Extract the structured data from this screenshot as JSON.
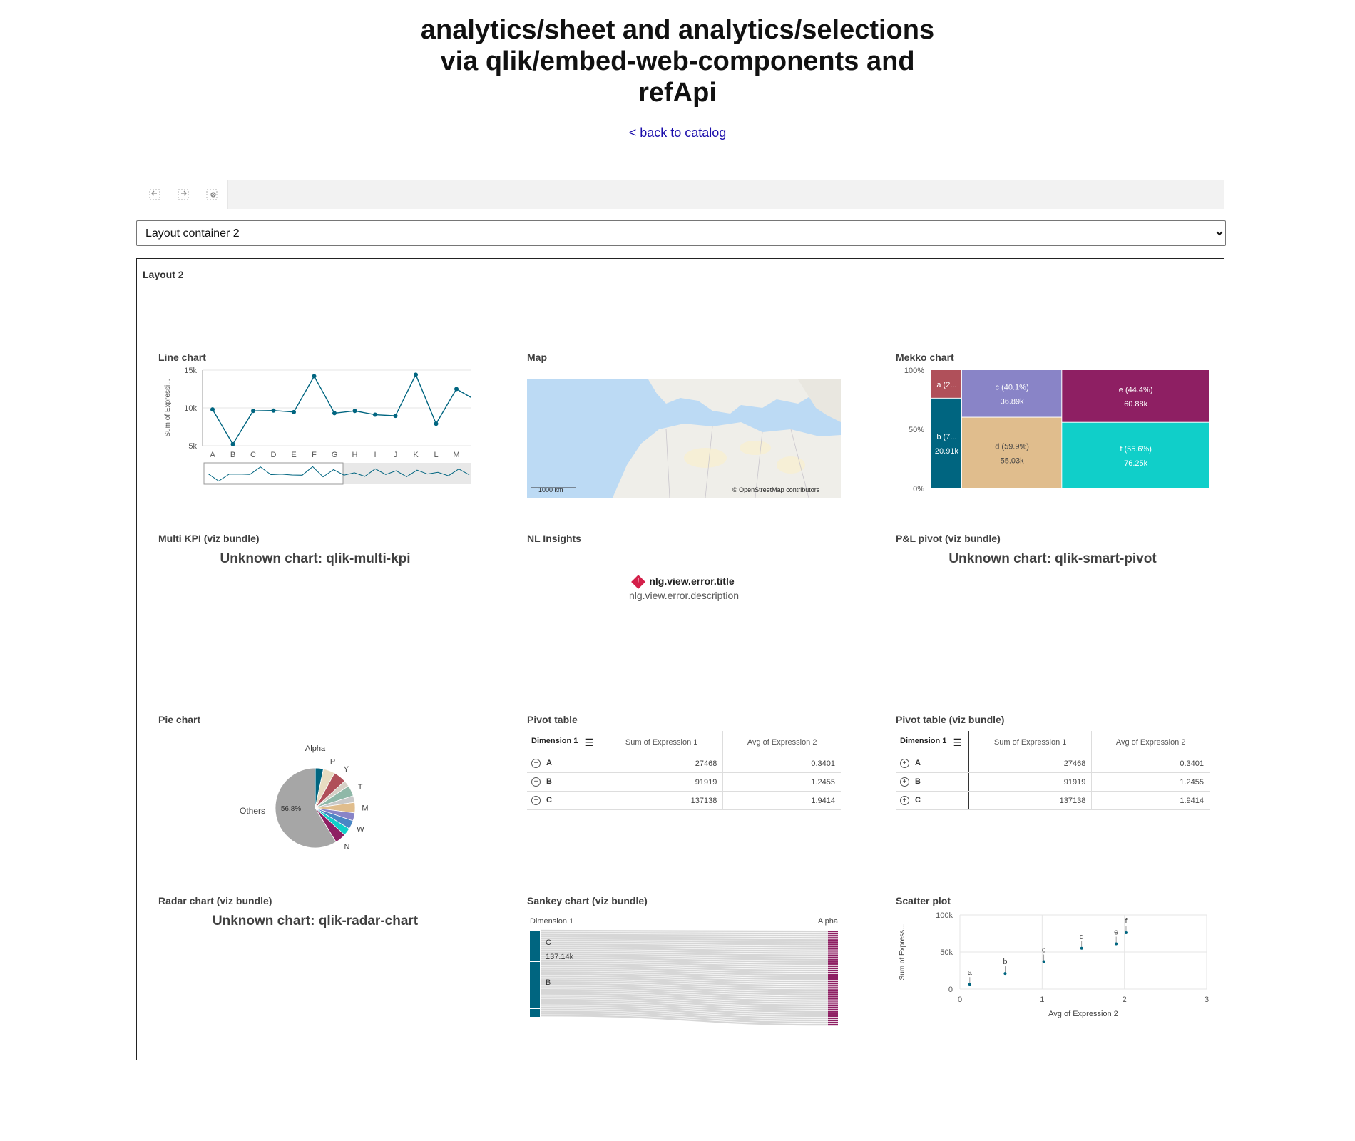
{
  "header": {
    "title_line1": "analytics/sheet and analytics/selections",
    "title_line2": "via qlik/embed-web-components and",
    "title_line3": "refApi",
    "back_link": "< back to catalog"
  },
  "toolbar": {
    "buttons": [
      "step-back-icon",
      "step-forward-icon",
      "clear-selections-icon"
    ]
  },
  "sheet_selector": {
    "value": "Layout container 2"
  },
  "layout": {
    "title": "Layout 2",
    "cells": {
      "line": "Line chart",
      "map": "Map",
      "mekko": "Mekko chart",
      "multikpi": "Multi KPI (viz bundle)",
      "nl": "NL Insights",
      "pnl": "P&L pivot (viz bundle)",
      "pie": "Pie chart",
      "pivot": "Pivot table",
      "pivot2": "Pivot table (viz bundle)",
      "radar": "Radar chart (viz bundle)",
      "sankey": "Sankey chart (viz bundle)",
      "scatter": "Scatter plot"
    },
    "unknown_multikpi": "Unknown chart: qlik-multi-kpi",
    "unknown_pnl": "Unknown chart: qlik-smart-pivot",
    "unknown_radar": "Unknown chart: qlik-radar-chart",
    "nl_error_title": "nlg.view.error.title",
    "nl_error_desc": "nlg.view.error.description",
    "map_scale": "1000 km",
    "map_attrib_prefix": "© ",
    "map_attrib_link": "OpenStreetMap",
    "map_attrib_suffix": " contributors",
    "pivot_table": {
      "headers": [
        "Dimension 1",
        "Sum of Expression 1",
        "Avg of Expression 2"
      ],
      "rows": [
        {
          "dim": "A",
          "sum": "27468",
          "avg": "0.3401"
        },
        {
          "dim": "B",
          "sum": "91919",
          "avg": "1.2455"
        },
        {
          "dim": "C",
          "sum": "137138",
          "avg": "1.9414"
        }
      ]
    }
  },
  "chart_data": [
    {
      "type": "line",
      "categories": [
        "A",
        "B",
        "C",
        "D",
        "E",
        "F",
        "G",
        "H",
        "I",
        "J",
        "K",
        "L",
        "M"
      ],
      "values": [
        9800,
        5200,
        9600,
        9650,
        9450,
        14200,
        9300,
        9600,
        9100,
        8950,
        14400,
        7900,
        12500
      ],
      "tail_value": 11400,
      "ylabel": "Sum of Expressi...",
      "yticks": [
        "5k",
        "10k",
        "15k"
      ],
      "ylim": [
        5000,
        15000
      ],
      "minimap_values": [
        9800,
        5200,
        9600,
        9650,
        9450,
        14200,
        9300,
        9600,
        9100,
        8950,
        14400,
        7900,
        12500,
        9000,
        10500,
        8200,
        13000,
        9400,
        11800,
        8000,
        12200,
        9700,
        10800,
        8600,
        12900,
        9200
      ]
    },
    {
      "type": "mekko",
      "yticks": [
        "0%",
        "50%",
        "100%"
      ],
      "columns": [
        {
          "segments": [
            {
              "label": "b (7...",
              "value": "20.91k",
              "share": 0.76,
              "color": "#006580"
            },
            {
              "label": "a (2...",
              "value": "",
              "share": 0.24,
              "color": "#b0505a"
            }
          ],
          "width": 0.11
        },
        {
          "segments": [
            {
              "label": "d (59.9%)",
              "value": "55.03k",
              "share": 0.599,
              "color": "#e0bd8d"
            },
            {
              "label": "c (40.1%)",
              "value": "36.89k",
              "share": 0.401,
              "color": "#8984c7"
            }
          ],
          "width": 0.36
        },
        {
          "segments": [
            {
              "label": "f (55.6%)",
              "value": "76.25k",
              "share": 0.556,
              "color": "#10cfc9"
            },
            {
              "label": "e (44.4%)",
              "value": "60.88k",
              "share": 0.444,
              "color": "#8e1f63"
            }
          ],
          "width": 0.53
        }
      ]
    },
    {
      "type": "pie",
      "title": "Alpha",
      "center_label": "56.8%",
      "others_label": "Others",
      "slices": [
        {
          "label": "",
          "value": 3.2,
          "color": "#006580"
        },
        {
          "label": "P",
          "value": 4.6,
          "color": "#e8dcc1"
        },
        {
          "label": "Y",
          "value": 5.0,
          "color": "#b0505a"
        },
        {
          "label": "",
          "value": 2.4,
          "color": "#d6d0c6"
        },
        {
          "label": "T",
          "value": 4.2,
          "color": "#8fb8a8"
        },
        {
          "label": "",
          "value": 2.6,
          "color": "#c9c9c9"
        },
        {
          "label": "M",
          "value": 4.1,
          "color": "#e0bd8d"
        },
        {
          "label": "",
          "value": 3.1,
          "color": "#8984c7"
        },
        {
          "label": "W",
          "value": 3.4,
          "color": "#4a86c5"
        },
        {
          "label": "",
          "value": 3.0,
          "color": "#10cfc9"
        },
        {
          "label": "N",
          "value": 4.3,
          "color": "#8e1f63"
        },
        {
          "label": "Others",
          "value": 56.8,
          "color": "#a6a6a6"
        }
      ]
    },
    {
      "type": "sankey",
      "left_title": "Dimension 1",
      "right_title": "Alpha",
      "left_nodes": [
        {
          "label": "C",
          "value": "137.14k"
        },
        {
          "label": "B",
          "value": ""
        },
        {
          "label": "",
          "value": ""
        }
      ]
    },
    {
      "type": "scatter",
      "xlabel": "Avg of Expression 2",
      "ylabel": "Sum of Express...",
      "xlim": [
        0,
        3
      ],
      "ylim": [
        0,
        100000
      ],
      "xticks": [
        "0",
        "1",
        "2",
        "3"
      ],
      "yticks": [
        "0",
        "50k",
        "100k"
      ],
      "points": [
        {
          "label": "a",
          "x": 0.12,
          "y": 6500
        },
        {
          "label": "b",
          "x": 0.55,
          "y": 21000
        },
        {
          "label": "c",
          "x": 1.02,
          "y": 37000
        },
        {
          "label": "d",
          "x": 1.48,
          "y": 55000
        },
        {
          "label": "e",
          "x": 1.9,
          "y": 61000
        },
        {
          "label": "f",
          "x": 2.02,
          "y": 76000
        }
      ]
    }
  ]
}
